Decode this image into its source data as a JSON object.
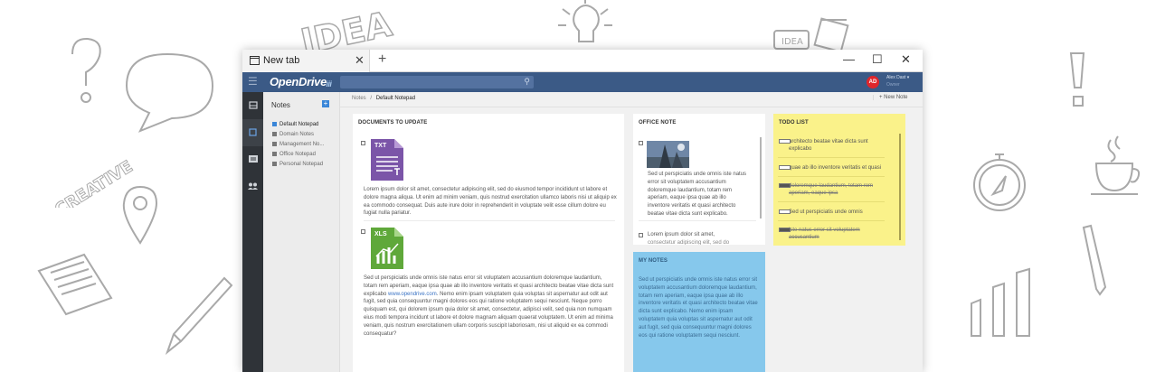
{
  "doodles": {
    "idea_word": "IDEA",
    "creative_word": "CREATIVE",
    "idea_box": "IDEA"
  },
  "window": {
    "tab_title": "New tab",
    "tab_close": "✕",
    "new_tab": "+",
    "minimize": "—",
    "maximize": "☐",
    "close": "✕"
  },
  "appbar": {
    "menu_icon": "☰",
    "logo_main": "OpenDrive",
    "logo_accent": "ᵢᵢᵢ",
    "search_placeholder": "",
    "avatar_initials": "AD",
    "user_name": "Alex Dast ▾",
    "user_role": "Owner"
  },
  "rail": [
    "drive-icon",
    "notes-icon",
    "tasks-icon",
    "users-icon"
  ],
  "sidebar": {
    "title": "Notes",
    "add_label": "+",
    "items": [
      {
        "label": "Default Notepad",
        "active": true
      },
      {
        "label": "Domain Notes",
        "active": false
      },
      {
        "label": "Management No...",
        "active": false
      },
      {
        "label": "Office Notepad",
        "active": false
      },
      {
        "label": "Personal Notepad",
        "active": false
      }
    ]
  },
  "breadcrumb": {
    "root": "Notes",
    "separator": "/",
    "current": "Default Notepad"
  },
  "toolbar": {
    "new_note": "+  New Note"
  },
  "documents": {
    "title": "DOCUMENTS TO UPDATE",
    "item1": {
      "badge": "TXT",
      "text": "Lorem ipsum dolor sit amet, consectetur adipiscing elit, sed do eiusmod tempor incididunt ut labore et dolore magna aliqua. Ut enim ad minim veniam, quis nostrud exercitation ullamco laboris nisi ut aliquip ex ea commodo consequat. Duis aute irure dolor in reprehenderit in voluptate velit esse cillum dolore eu fugiat nulla pariatur."
    },
    "item2": {
      "badge": "XLS",
      "text_before": "Sed ut perspiciatis unde omnis iste natus error sit voluptatem accusantium doloremque laudantium, totam rem aperiam, eaque ipsa quae ab illo inventore veritatis et quasi architecto beatae vitae dicta sunt explicabo ",
      "link": "www.opendrive.com",
      "text_after": ".   Nemo enim ipsam voluptatem quia voluptas sit aspernatur aut odit aut fugit, sed quia consequuntur magni dolores eos qui ratione voluptatem sequi nesciunt.   Neque porro quisquam est, qui dolorem ipsum quia dolor sit amet, consectetur, adipisci velit, sed quia non numquam eius modi tempora incidunt ut labore et dolore magnam aliquam quaerat voluptatem.   Ut enim ad minima veniam, quis nostrum exercitationem ullam corporis suscipit laboriosam, nisi ut aliquid ex ea commodi consequatur?"
    }
  },
  "office": {
    "title": "OFFICE NOTE",
    "text1": "Sed ut perspiciatis unde omnis iste natus error sit voluptatem accusantium doloremque laudantium, totam rem aperiam, eaque ipsa quae ab illo inventore veritatis et quasi architecto beatae vitae dicta sunt explicabo.",
    "text2": "Lorem ipsum dolor sit amet,",
    "text2_cut": "consectetur adipiscing elit, sed do"
  },
  "todo": {
    "title": "TODO LIST",
    "items": [
      {
        "label": "architecto beatae vitae dicta sunt explicabo",
        "done": false
      },
      {
        "label": "quae ab illo inventore veritatis et quasi",
        "done": false
      },
      {
        "label": "doloremque laudantium, totam rem aperiam, eaque ipsa",
        "done": true
      },
      {
        "label": "Sed ut perspiciatis unde omnis",
        "done": false
      },
      {
        "label": "iste natus error sit voluptatem accusantium",
        "done": true
      }
    ]
  },
  "mynotes": {
    "title": "MY NOTES",
    "text": "Sed ut perspiciatis unde omnis iste natus error sit voluptatem accusantium doloremque laudantium, totam rem aperiam, eaque ipsa quae ab illo inventore veritatis et quasi architecto beatae vitae dicta sunt explicabo.    Nemo enim ipsam voluptatem quia voluptas sit aspernatur aut odit aut fugit, sed quia consequuntur magni dolores eos qui ratione voluptatem sequi nesciunt."
  },
  "colors": {
    "appbar": "#3b5a86",
    "todo_bg": "#faf28a",
    "mynotes_bg": "#86c8ec",
    "txt_icon": "#7b55a8",
    "xls_icon": "#5fa83a",
    "avatar": "#e0262b"
  }
}
